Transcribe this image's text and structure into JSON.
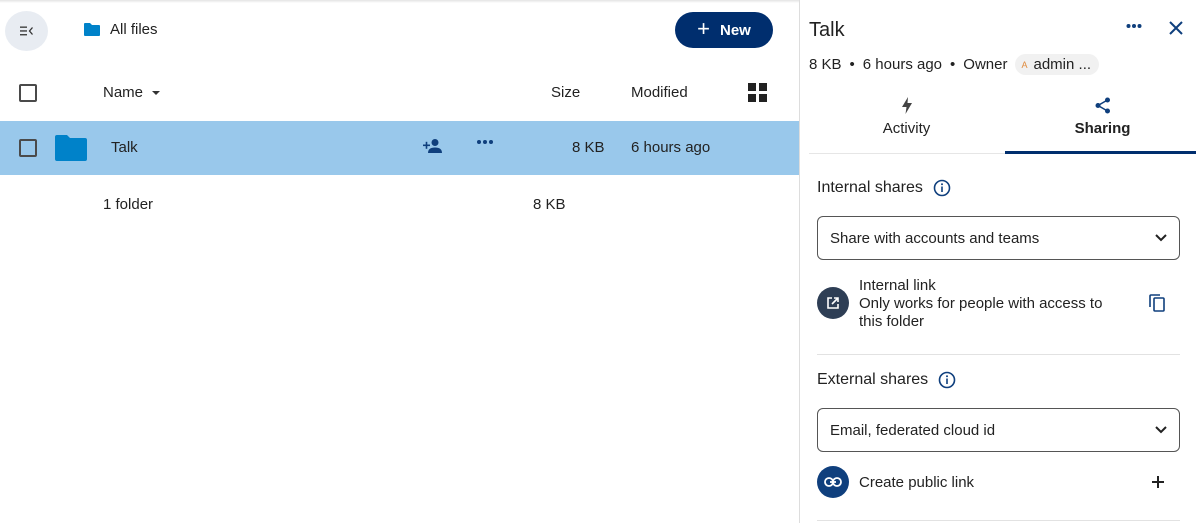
{
  "breadcrumb": {
    "label": "All files"
  },
  "toolbar": {
    "new_label": "New"
  },
  "table": {
    "headers": {
      "name": "Name",
      "size": "Size",
      "modified": "Modified"
    },
    "rows": [
      {
        "name": "Talk",
        "size": "8 KB",
        "modified": "6 hours ago"
      }
    ],
    "summary": {
      "count": "1 folder",
      "total": "8 KB"
    }
  },
  "sidebar": {
    "title": "Talk",
    "meta": {
      "size": "8 KB",
      "time": "6 hours ago",
      "owner_label": "Owner",
      "owner_avatar": "A",
      "owner_name": "admin ..."
    },
    "tabs": [
      {
        "label": "Activity"
      },
      {
        "label": "Sharing"
      }
    ],
    "internal": {
      "title": "Internal shares",
      "placeholder": "Share with accounts and teams",
      "link_title": "Internal link",
      "link_desc": "Only works for people with access to this folder"
    },
    "external": {
      "title": "External shares",
      "placeholder": "Email, federated cloud id",
      "create_link": "Create public link"
    }
  },
  "colors": {
    "primary": "#002e6e",
    "selected_row": "#99c8eb",
    "folder": "#0082c9",
    "avatar": "#e08a3c"
  }
}
